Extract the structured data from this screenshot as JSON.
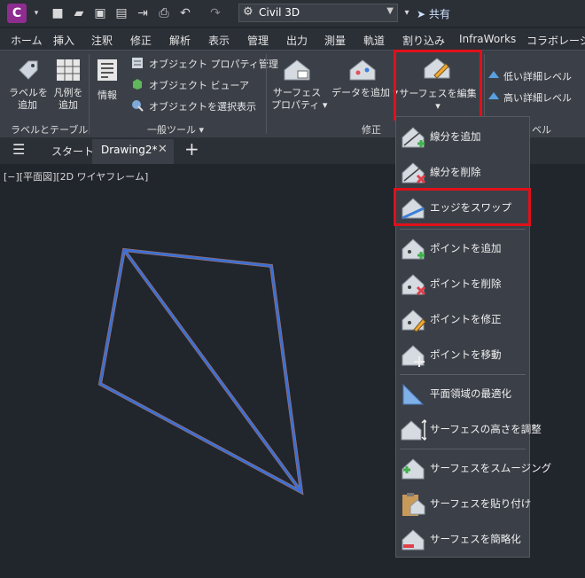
{
  "app": {
    "logo_letter": "C",
    "workspace": "Civil 3D",
    "share": "共有"
  },
  "tabs": [
    "ホーム",
    "挿入",
    "注釈",
    "修正",
    "解析",
    "表示",
    "管理",
    "出力",
    "測量",
    "軌道",
    "割り込み",
    "InfraWorks",
    "コラボレーション"
  ],
  "ribbon": {
    "label_btn": [
      "ラベルを",
      "追加"
    ],
    "legend_btn": [
      "凡例を",
      "追加"
    ],
    "info_btn": "情報",
    "object_property": "オブジェクト プロパティ管理",
    "object_viewer": "オブジェクト ビューア",
    "select_show": "オブジェクトを選択表示",
    "surface_prop": [
      "サーフェス",
      "プロパティ"
    ],
    "data_add": "データを追加",
    "surface_edit": "サーフェスを編集",
    "low_detail": "低い詳細レベル",
    "high_detail": "高い詳細レベル",
    "panel_labels": {
      "labels": "ラベルとテーブル",
      "general": "一般ツール",
      "modify": "修正",
      "level": "ベル"
    }
  },
  "doc": {
    "start": "スタート",
    "drawing": "Drawing2*"
  },
  "viewport_label": "[−][平面図][2D ワイヤフレーム]",
  "menu": [
    "線分を追加",
    "線分を削除",
    "エッジをスワップ",
    "ポイントを追加",
    "ポイントを削除",
    "ポイントを修正",
    "ポイントを移動",
    "平面領域の最適化",
    "サーフェスの高さを調整",
    "サーフェスをスムージング",
    "サーフェスを貼り付け",
    "サーフェスを簡略化"
  ],
  "colors": {
    "highlight": "#e0101a",
    "wire": "#3a6fd8",
    "accent": "#8e2c8f"
  }
}
